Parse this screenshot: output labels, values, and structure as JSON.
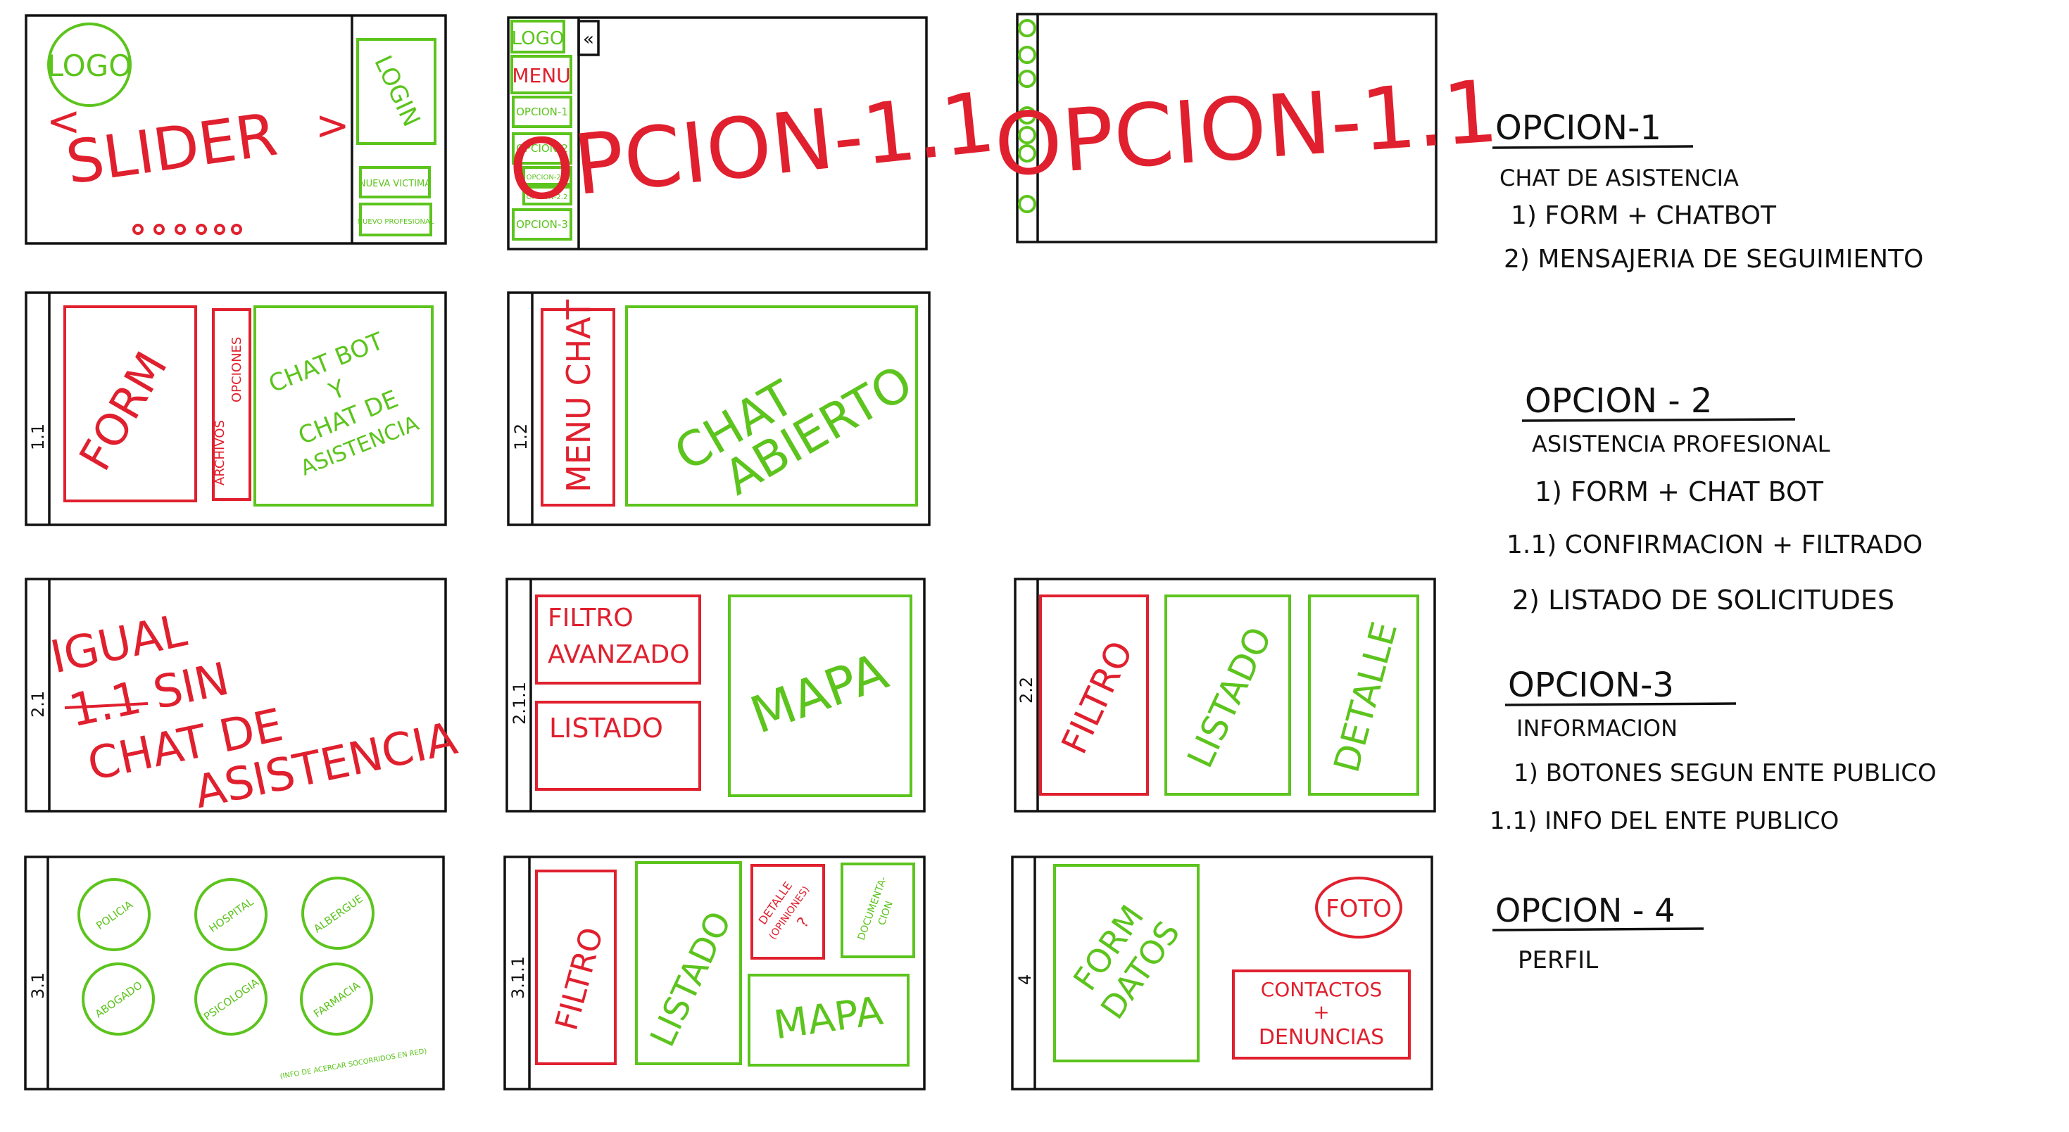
{
  "colors": {
    "red": "#e0202e",
    "green": "#5cc41d",
    "ink": "#111111"
  },
  "frame1": {
    "logo": "LOGO",
    "slider": "SLIDER",
    "prev": "<",
    "next": ">",
    "login": "LOGIN",
    "nueva_victima": "NUEVA VICTIMA",
    "nuevo_profesional": "NUEVO PROFESIONAL"
  },
  "frame2": {
    "logo": "LOGO",
    "collapse": "«",
    "menu": "MENU",
    "items": [
      "OPCION-1",
      "OPCION-2",
      "OPCION-2.1",
      "OPCION-2.2",
      "OPCION-3"
    ],
    "content": "OPCION-1.1"
  },
  "frame3": {
    "content": "OPCION-1.1"
  },
  "frame_1_1": {
    "id": "1.1",
    "form": "FORM",
    "archivos": "ARCHIVOS",
    "opciones": "OPCIONES",
    "chat_l1": "CHAT BOT",
    "chat_l2": "Y",
    "chat_l3": "CHAT DE",
    "chat_l4": "ASISTENCIA"
  },
  "frame_1_2": {
    "id": "1.2",
    "menu_chat": "MENU CHAT",
    "chat_l1": "CHAT",
    "chat_l2": "ABIERTO"
  },
  "frame_2_1": {
    "id": "2.1",
    "l1": "IGUAL",
    "l2": "1.1 SIN",
    "l3": "CHAT DE",
    "l4": "ASISTENCIA"
  },
  "frame_2_1_1": {
    "id": "2.1.1",
    "filtro_l1": "FILTRO",
    "filtro_l2": "AVANZADO",
    "listado": "LISTADO",
    "mapa": "MAPA"
  },
  "frame_2_2": {
    "id": "2.2",
    "filtro": "FILTRO",
    "listado": "LISTADO",
    "detalle": "DETALLE"
  },
  "frame_3_1": {
    "id": "3.1",
    "circles": [
      "POLICIA",
      "HOSPITAL",
      "ALBERGUE",
      "ABOGADO",
      "PSICOLOGIA",
      "FARMACIA"
    ],
    "note": "(INFO DE ACERCAR SOCORRIDOS EN RED)"
  },
  "frame_3_1_1": {
    "id": "3.1.1",
    "filtro": "FILTRO",
    "listado": "LISTADO",
    "detalle_l1": "DETALLE",
    "detalle_l2": "(OPINIONES)",
    "detalle_l3": "?",
    "doc_l1": "DOCUMENTA-",
    "doc_l2": "CION",
    "mapa": "MAPA"
  },
  "frame_4": {
    "id": "4",
    "form_l1": "FORM",
    "form_l2": "DATOS",
    "foto": "FOTO",
    "contactos_l1": "CONTACTOS",
    "contactos_l2": "+",
    "contactos_l3": "DENUNCIAS"
  },
  "notes": {
    "opcion1": {
      "title": "OPCION-1",
      "subtitle": "CHAT DE ASISTENCIA",
      "items": [
        "1) FORM + CHATBOT",
        "2) MENSAJERIA DE SEGUIMIENTO"
      ]
    },
    "opcion2": {
      "title": "OPCION - 2",
      "subtitle": "ASISTENCIA PROFESIONAL",
      "items": [
        "1) FORM + CHAT BOT",
        "1.1) CONFIRMACION + FILTRADO",
        "2) LISTADO DE SOLICITUDES"
      ]
    },
    "opcion3": {
      "title": "OPCION-3",
      "subtitle": "INFORMACION",
      "items": [
        "1) BOTONES SEGUN ENTE PUBLICO",
        "1.1) INFO DEL ENTE PUBLICO"
      ]
    },
    "opcion4": {
      "title": "OPCION - 4",
      "subtitle": "PERFIL"
    }
  }
}
